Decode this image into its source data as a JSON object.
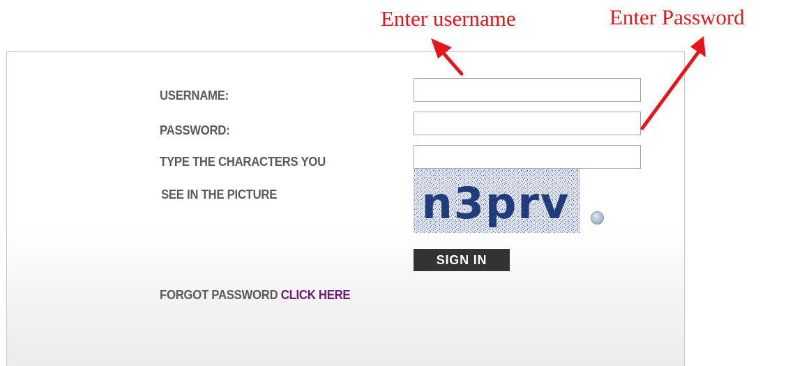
{
  "annotations": {
    "username_hint": "Enter username",
    "password_hint": "Enter Password",
    "color": "#e8141c"
  },
  "login_form": {
    "username_label": "USERNAME:",
    "password_label": "PASSWORD:",
    "captcha_label_line1": "TYPE THE CHARACTERS YOU",
    "captcha_label_line2": "SEE IN THE PICTURE",
    "username_value": "",
    "password_value": "",
    "captcha_value": "",
    "captcha_text": "n3prv",
    "refresh_icon": "refresh-icon",
    "signin_label": "SIGN IN",
    "forgot_text": "FORGOT PASSWORD",
    "forgot_link": "CLICK HERE"
  },
  "colors": {
    "label": "#5a5a5a",
    "link": "#6a1b78",
    "button_bg": "#333333",
    "captcha_text": "#1f3a7a"
  }
}
